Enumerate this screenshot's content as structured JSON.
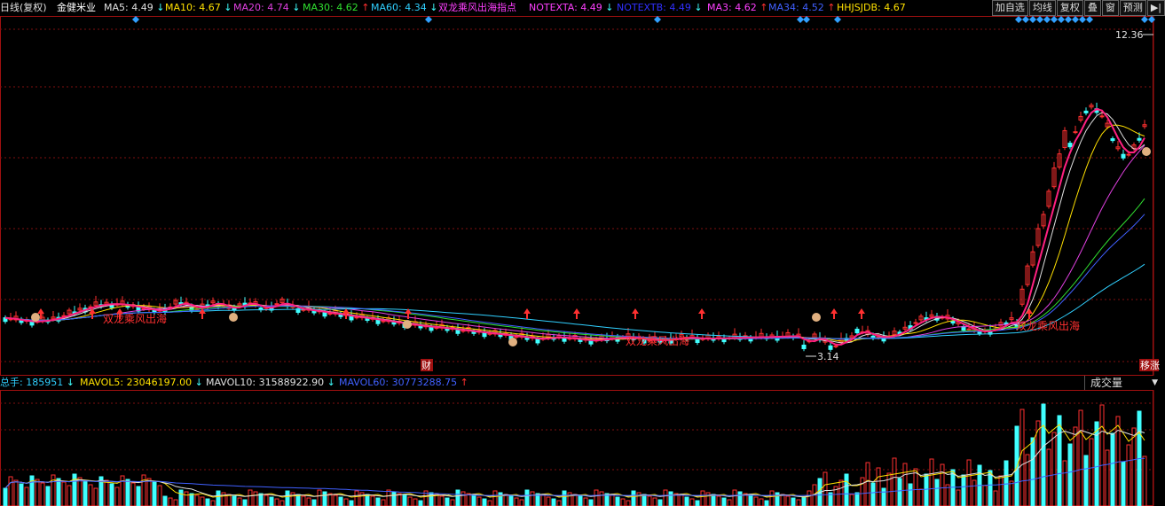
{
  "header": {
    "period": "日线(复权)",
    "stock_name": "金健米业",
    "indicators": [
      {
        "name": "MA5",
        "value": "4.49",
        "dir": "down",
        "color": "#e0e0e0"
      },
      {
        "name": "MA10",
        "value": "4.67",
        "dir": "down",
        "color": "#ffe000"
      },
      {
        "name": "MA20",
        "value": "4.74",
        "dir": "down",
        "color": "#e040e0"
      },
      {
        "name": "MA30",
        "value": "4.62",
        "dir": "up",
        "color": "#30e030"
      },
      {
        "name": "MA60",
        "value": "4.34",
        "dir": "down",
        "color": "#30d0ff"
      },
      {
        "name": "双龙乘风出海指点",
        "value": "",
        "dir": "",
        "color": "#ff40ff"
      },
      {
        "name": "NOTEXTA",
        "value": "4.49",
        "dir": "down",
        "color": "#ff40ff"
      },
      {
        "name": "NOTEXTB",
        "value": "4.49",
        "dir": "down",
        "color": "#3030ff"
      },
      {
        "name": "MA3",
        "value": "4.62",
        "dir": "up",
        "color": "#ff40ff"
      },
      {
        "name": "MA34",
        "value": "4.52",
        "dir": "up",
        "color": "#4060ff"
      },
      {
        "name": "HHJSJDB",
        "value": "4.67",
        "dir": "",
        "color": "#ffe000"
      }
    ]
  },
  "toolbar": {
    "buttons": [
      "加自选",
      "均线",
      "复权",
      "叠",
      "窗",
      "预测",
      "▶|"
    ]
  },
  "chart_annotations": {
    "high_label": "12.36",
    "low_label": "3.14",
    "signal_label": "双龙乘风出海",
    "event_marker_1": "财",
    "event_marker_2": "移涨"
  },
  "volume_header": {
    "items": [
      {
        "name": "总手",
        "value": "185951",
        "dir": "down",
        "color": "#30d0ff"
      },
      {
        "name": "MAVOL5",
        "value": "23046197.00",
        "dir": "down",
        "color": "#ffe000"
      },
      {
        "name": "MAVOL10",
        "value": "31588922.90",
        "dir": "down",
        "color": "#e0e0e0"
      },
      {
        "name": "MAVOL60",
        "value": "30773288.75",
        "dir": "up",
        "color": "#4060ff"
      }
    ],
    "selector": "成交量"
  },
  "colors": {
    "up": "#ff3030",
    "down": "#40ffff",
    "grid": "#801010"
  }
}
